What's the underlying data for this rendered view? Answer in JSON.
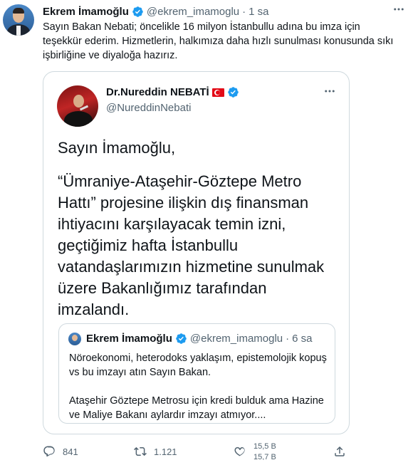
{
  "tweet": {
    "author_name": "Ekrem İmamoğlu",
    "author_handle": "@ekrem_imamoglu",
    "separator": "·",
    "time": "1 sa",
    "text": "Sayın Bakan Nebati; öncelikle 16 milyon İstanbullu adına bu imza için teşekkür ederim. Hizmetlerin, halkımıza daha hızlı sunulması konusunda sıkı işbirliğine ve diyaloğa hazırız.",
    "more_icon": "more-icon",
    "verified_color": "#1d9bf0"
  },
  "quoted": {
    "author_name": "Dr.Nureddin NEBATİ",
    "author_handle": "@NureddinNebati",
    "body_greeting": "Sayın İmamoğlu,",
    "body_text": "“Ümraniye-Ataşehir-Göztepe Metro Hattı” projesine ilişkin dış finansman ihtiyacını karşılayacak temin izni, geçtiğimiz hafta İstanbullu vatandaşlarımızın hizmetine sunulmak üzere Bakanlığımız tarafından imzalandı."
  },
  "nested": {
    "author_name": "Ekrem İmamoğlu",
    "author_handle": "@ekrem_imamoglu",
    "separator": "·",
    "time": "6 sa",
    "text_line1": "Nöroekonomi, heterodoks yaklaşım, epistemolojik kopuş vs bu imzayı atın Sayın Bakan.",
    "text_line2": "Ataşehir Göztepe Metrosu için kredi bulduk ama Hazine ve Maliye Bakanı aylardır imzayı atmıyor...."
  },
  "actions": {
    "reply_count": "841",
    "retweet_count": "1.121",
    "like_count_top": "15,5 B",
    "like_count_bottom": "15,7 B",
    "icon_color": "#536471"
  }
}
